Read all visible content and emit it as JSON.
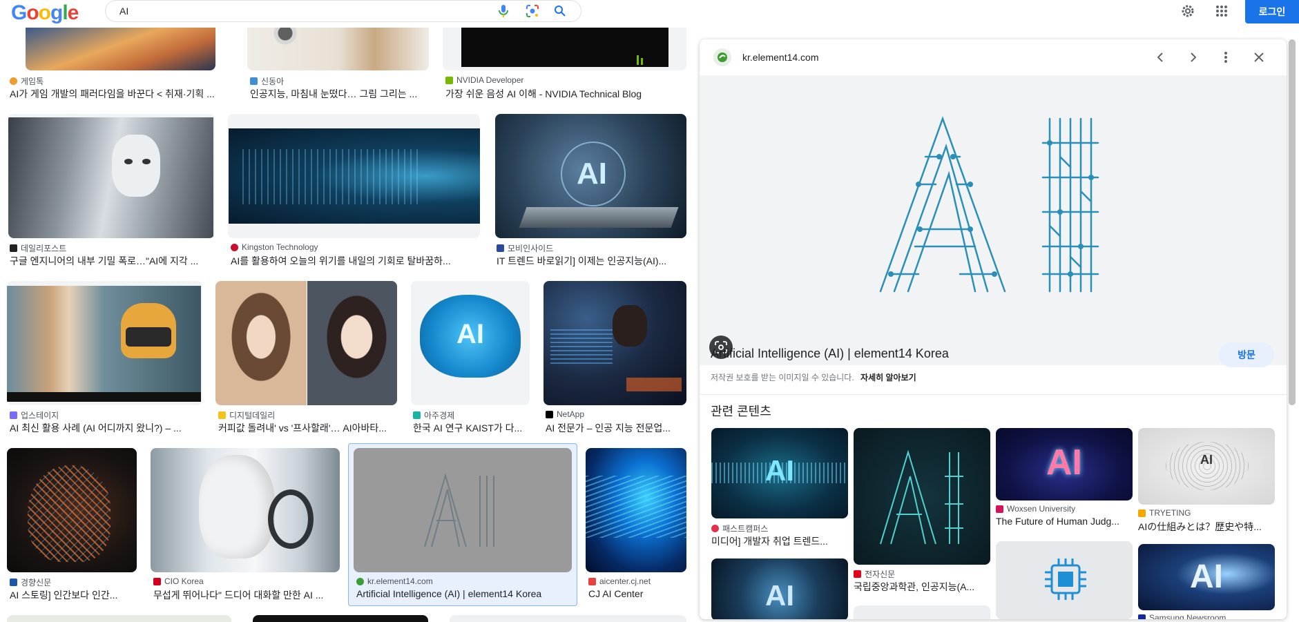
{
  "header": {
    "logo": "Google",
    "query": "AI",
    "login": "로그인"
  },
  "grid": {
    "row0": [
      {
        "source": "게임톡",
        "caption": "AI가 게임 개발의 패러다임을 바꾼다 < 취재·기획 ..."
      },
      {
        "source": "신동아",
        "caption": "인공지능, 마침내 눈떴다… 그림 그리는 ..."
      },
      {
        "source": "NVIDIA Developer",
        "caption": "가장 쉬운 음성 AI 이해 - NVIDIA Technical Blog"
      }
    ],
    "row1": [
      {
        "source": "데일리포스트",
        "caption": "구글 엔지니어의 내부 기밀 폭로…\"AI에 지각 ..."
      },
      {
        "source": "Kingston Technology",
        "caption": "AI를 활용하여 오늘의 위기를 내일의 기회로 탈바꿈하..."
      },
      {
        "source": "모비인사이드",
        "caption": "IT 트렌드 바로읽기] 이제는 인공지능(AI)..."
      }
    ],
    "row2": [
      {
        "source": "업스테이지",
        "caption": "AI 최신 활용 사례 (AI 어디까지 왔니?) – ..."
      },
      {
        "source": "디지털데일리",
        "caption": "커피값 돌려내' vs '프사할래'… AI아바타..."
      },
      {
        "source": "아주경제",
        "caption": "한국 AI 연구 KAIST가 다..."
      },
      {
        "source": "NetApp",
        "caption": "AI 전문가 – 인공 지능 전문업..."
      }
    ],
    "row3": [
      {
        "source": "경향신문",
        "caption": "AI 스토링] 인간보다 인간..."
      },
      {
        "source": "CIO Korea",
        "caption": "무섭게 뛰어나다\" 드디어 대화할 만한 AI ..."
      },
      {
        "source": "kr.element14.com",
        "caption": "Artificial Intelligence (AI) | element14 Korea"
      },
      {
        "source": "aicenter.cj.net",
        "caption": "CJ AI Center"
      }
    ],
    "tile_texts": {
      "kaist": "AI",
      "laptop": "AI"
    }
  },
  "panel": {
    "domain": "kr.element14.com",
    "title": "Artificial Intelligence (AI) | element14 Korea",
    "visit": "방문",
    "copyright": "저작권 보호를 받는 이미지일 수 있습니다.",
    "learn_more": "자세히 알아보기",
    "related_heading": "관련 콘텐츠",
    "related": [
      {
        "source": "패스트캠퍼스",
        "caption": "미디어] 개발자 취업 트렌드...",
        "text": "AI"
      },
      {
        "source": "전자신문",
        "caption": "국립중앙과학관, 인공지능(A...",
        "text": "AI"
      },
      {
        "source": "Woxsen University",
        "caption": "The Future of Human Judg...",
        "text": "AI"
      },
      {
        "source": "TRYETING",
        "caption": "AIの仕組みとは？歴史や特...",
        "text": "AI"
      },
      {
        "source": "Samsung Newsroom",
        "caption": "",
        "text": "AI"
      }
    ],
    "hero_text": "AI"
  },
  "colors": {
    "accent": "#1a73e8",
    "circuit": "#2a8fb6"
  }
}
